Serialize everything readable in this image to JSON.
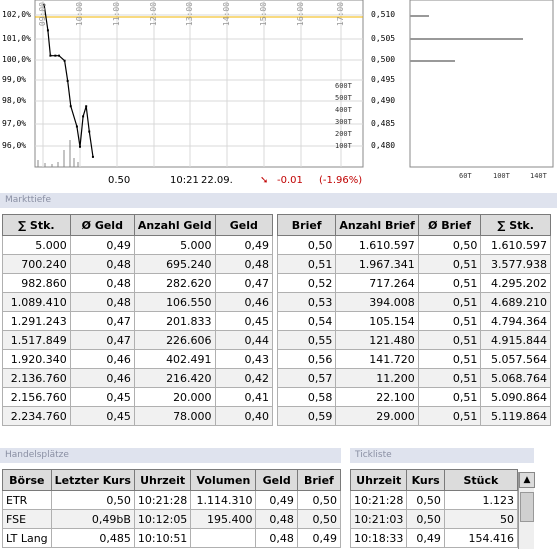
{
  "chart": {
    "left_axis": [
      "102,0%",
      "101,0%",
      "100,0%",
      "99,0%",
      "98,0%",
      "97,0%",
      "96,0%"
    ],
    "right_axis": [
      "0,510",
      "0,505",
      "0,500",
      "0,495",
      "0,490",
      "0,485",
      "0,480"
    ],
    "time_labels": [
      "09:00",
      "10:00",
      "11:00",
      "12:00",
      "13:00",
      "14:00",
      "15:00",
      "16:00",
      "17:00"
    ],
    "volume_labels": [
      "600T",
      "500T",
      "400T",
      "300T",
      "200T",
      "100T"
    ],
    "depth_x_labels": [
      "60T",
      "100T",
      "140T"
    ],
    "accent_color": "#f0b400",
    "down_color": "#c00000"
  },
  "chart_data": {
    "type": "line",
    "title": "",
    "xlabel": "",
    "ylabel": "",
    "series": [
      {
        "x": [
          "09:02",
          "09:08",
          "09:12",
          "09:20",
          "09:26",
          "09:35",
          "09:40",
          "09:45",
          "09:55",
          "10:00",
          "10:05",
          "10:10",
          "10:15",
          "10:21"
        ],
        "values": [
          0.51,
          0.505,
          0.5,
          0.5,
          0.5,
          0.499,
          0.495,
          0.49,
          0.486,
          0.482,
          0.488,
          0.49,
          0.485,
          0.48
        ]
      }
    ],
    "ylim": [
      0.478,
      0.511
    ],
    "reference_line": 0.51
  },
  "info": {
    "price": "0.50",
    "time": "10:21",
    "date": "22.09.",
    "arrow": "➘",
    "change": "-0.01",
    "change_pct": "(-1.96%)"
  },
  "markttiefe": {
    "section_title": "Markttiefe",
    "bid_headers": [
      "∑ Stk.",
      "Ø Geld",
      "Anzahl Geld",
      "Geld"
    ],
    "ask_headers": [
      "Brief",
      "Anzahl Brief",
      "Ø Brief",
      "∑ Stk."
    ],
    "bid_rows": [
      [
        "5.000",
        "0,49",
        "5.000",
        "0,49"
      ],
      [
        "700.240",
        "0,48",
        "695.240",
        "0,48"
      ],
      [
        "982.860",
        "0,48",
        "282.620",
        "0,47"
      ],
      [
        "1.089.410",
        "0,48",
        "106.550",
        "0,46"
      ],
      [
        "1.291.243",
        "0,47",
        "201.833",
        "0,45"
      ],
      [
        "1.517.849",
        "0,47",
        "226.606",
        "0,44"
      ],
      [
        "1.920.340",
        "0,46",
        "402.491",
        "0,43"
      ],
      [
        "2.136.760",
        "0,46",
        "216.420",
        "0,42"
      ],
      [
        "2.156.760",
        "0,45",
        "20.000",
        "0,41"
      ],
      [
        "2.234.760",
        "0,45",
        "78.000",
        "0,40"
      ]
    ],
    "ask_rows": [
      [
        "0,50",
        "1.610.597",
        "0,50",
        "1.610.597"
      ],
      [
        "0,51",
        "1.967.341",
        "0,51",
        "3.577.938"
      ],
      [
        "0,52",
        "717.264",
        "0,51",
        "4.295.202"
      ],
      [
        "0,53",
        "394.008",
        "0,51",
        "4.689.210"
      ],
      [
        "0,54",
        "105.154",
        "0,51",
        "4.794.364"
      ],
      [
        "0,55",
        "121.480",
        "0,51",
        "4.915.844"
      ],
      [
        "0,56",
        "141.720",
        "0,51",
        "5.057.564"
      ],
      [
        "0,57",
        "11.200",
        "0,51",
        "5.068.764"
      ],
      [
        "0,58",
        "22.100",
        "0,51",
        "5.090.864"
      ],
      [
        "0,59",
        "29.000",
        "0,51",
        "5.119.864"
      ]
    ]
  },
  "handelsplaetze": {
    "section_title": "Handelsplätze",
    "headers": [
      "Börse",
      "Letzter Kurs",
      "Uhrzeit",
      "Volumen",
      "Geld",
      "Brief"
    ],
    "rows": [
      [
        "ETR",
        "0,50",
        "10:21:28",
        "1.114.310",
        "0,49",
        "0,50"
      ],
      [
        "FSE",
        "0,49bB",
        "10:12:05",
        "195.400",
        "0,48",
        "0,50"
      ],
      [
        "LT Lang",
        "0,485",
        "10:10:51",
        "",
        "0,48",
        "0,49"
      ]
    ]
  },
  "tickliste": {
    "section_title": "Tickliste",
    "headers": [
      "Uhrzeit",
      "Kurs",
      "Stück"
    ],
    "rows": [
      [
        "10:21:28",
        "0,50",
        "1.123"
      ],
      [
        "10:21:03",
        "0,50",
        "50"
      ],
      [
        "10:18:33",
        "0,49",
        "154.416"
      ]
    ],
    "scroll_up_glyph": "▲"
  }
}
